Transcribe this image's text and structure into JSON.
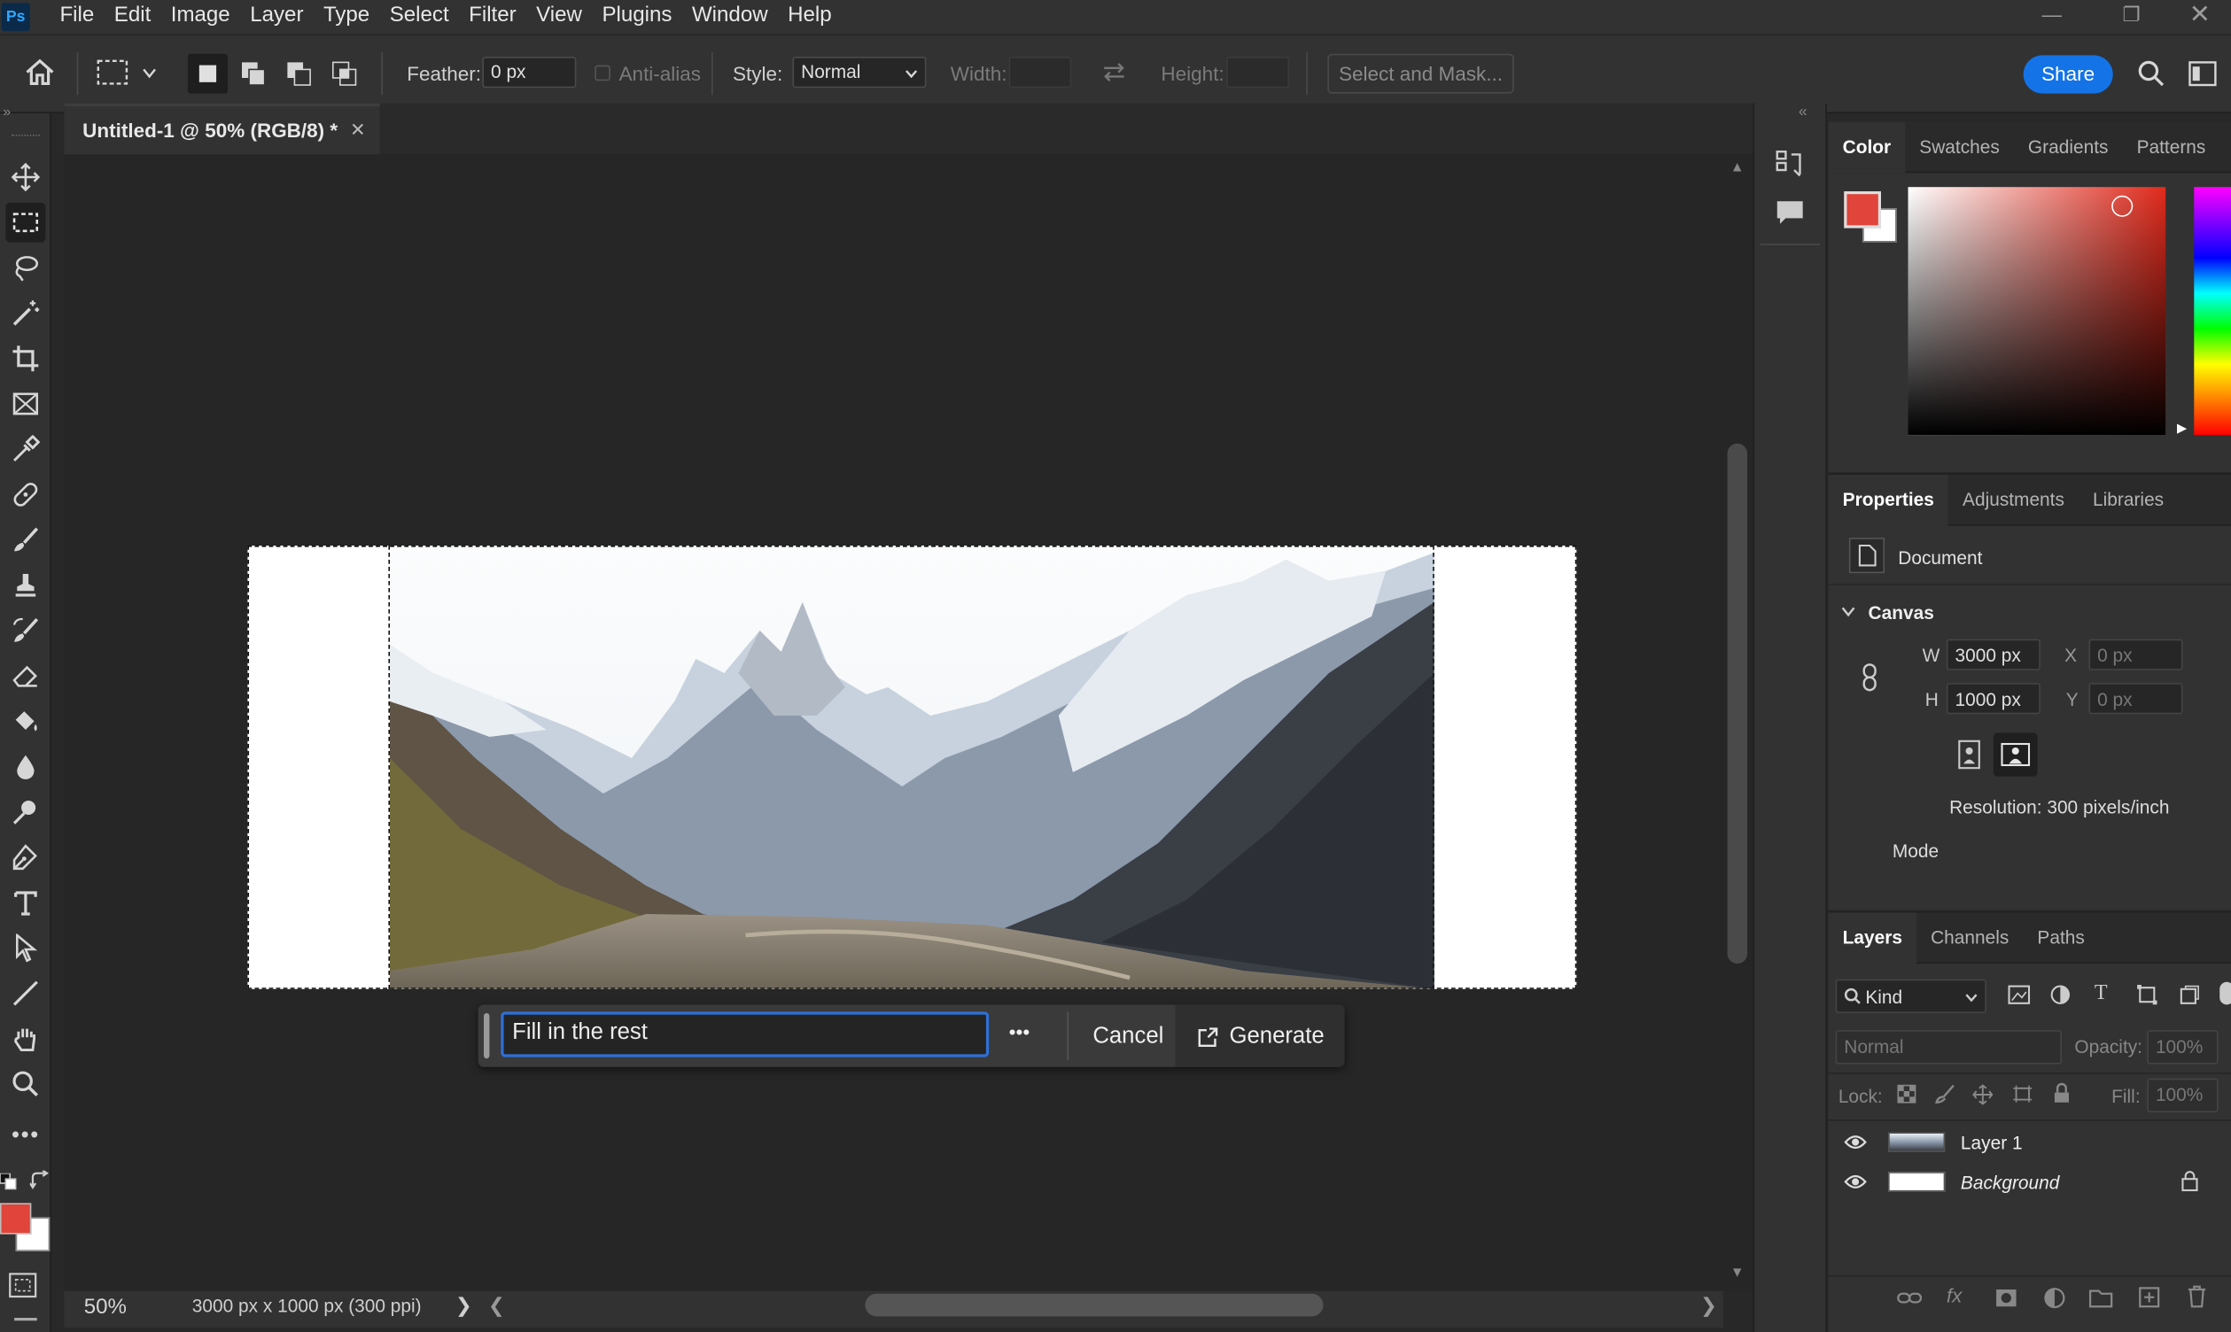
{
  "app": {
    "logo": "Ps",
    "brand_color": "#31a8ff"
  },
  "menu": [
    "File",
    "Edit",
    "Image",
    "Layer",
    "Type",
    "Select",
    "Filter",
    "View",
    "Plugins",
    "Window",
    "Help"
  ],
  "options": {
    "feather_label": "Feather:",
    "feather_value": "0 px",
    "antialias_label": "Anti-alias",
    "style_label": "Style:",
    "style_value": "Normal",
    "width_label": "Width:",
    "height_label": "Height:",
    "select_mask": "Select and Mask...",
    "share": "Share"
  },
  "document": {
    "tab_title": "Untitled-1 @ 50% (RGB/8) *",
    "zoom": "50%",
    "doc_info": "3000 px x 1000 px (300 ppi)"
  },
  "generative_fill": {
    "prompt": "Fill in the rest",
    "more": "•••",
    "cancel": "Cancel",
    "generate": "Generate"
  },
  "color_panel": {
    "tabs": [
      "Color",
      "Swatches",
      "Gradients",
      "Patterns"
    ],
    "foreground": "#e0443a",
    "background": "#ffffff",
    "hue_color": "#e02a1c"
  },
  "properties_panel": {
    "tabs": [
      "Properties",
      "Adjustments",
      "Libraries"
    ],
    "document_label": "Document",
    "canvas_label": "Canvas",
    "w_label": "W",
    "w_value": "3000 px",
    "h_label": "H",
    "h_value": "1000 px",
    "x_label": "X",
    "x_value": "0 px",
    "y_label": "Y",
    "y_value": "0 px",
    "resolution": "Resolution: 300 pixels/inch",
    "mode_label": "Mode"
  },
  "layers_panel": {
    "tabs": [
      "Layers",
      "Channels",
      "Paths"
    ],
    "kind": "Kind",
    "blend": "Normal",
    "opacity_label": "Opacity:",
    "opacity_value": "100%",
    "lock_label": "Lock:",
    "fill_label": "Fill:",
    "fill_value": "100%",
    "layers": [
      {
        "name": "Layer 1",
        "italic": false
      },
      {
        "name": "Background",
        "italic": true
      }
    ]
  },
  "icons": {
    "home": "home-icon",
    "search": "search-icon",
    "panel": "panel-toggle-icon"
  }
}
